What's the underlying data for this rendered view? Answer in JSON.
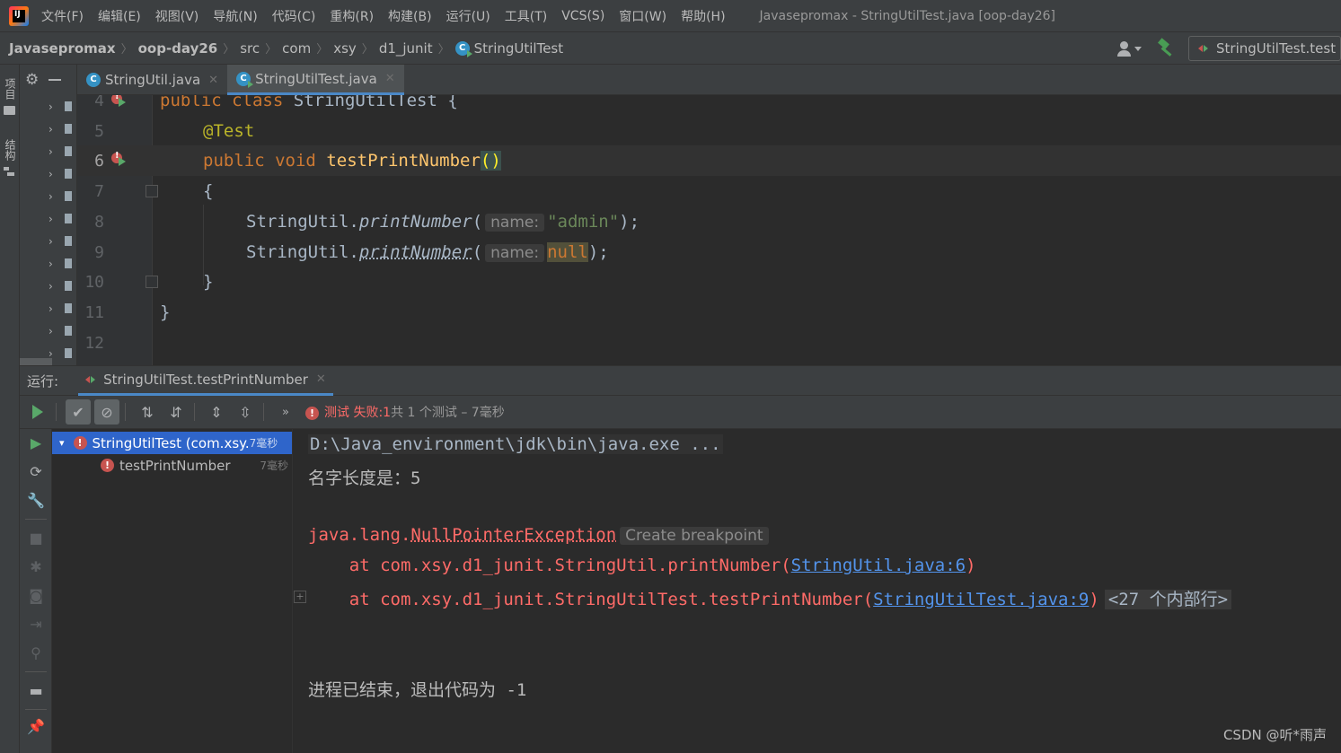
{
  "menubar": {
    "items": [
      "文件(F)",
      "编辑(E)",
      "视图(V)",
      "导航(N)",
      "代码(C)",
      "重构(R)",
      "构建(B)",
      "运行(U)",
      "工具(T)",
      "VCS(S)",
      "窗口(W)",
      "帮助(H)"
    ],
    "window_title": "Javasepromax - StringUtilTest.java [oop-day26]"
  },
  "navbar": {
    "crumbs": [
      "Javasepromax",
      "oop-day26",
      "src",
      "com",
      "xsy",
      "d1_junit",
      "StringUtilTest"
    ],
    "run_config": "StringUtilTest.test"
  },
  "left_strip": {
    "project_tab": "项目",
    "structure_tab": "结构"
  },
  "editor_tabs": [
    {
      "label": "StringUtil.java",
      "active": false
    },
    {
      "label": "StringUtilTest.java",
      "active": true
    }
  ],
  "editor": {
    "line_numbers": [
      "4",
      "5",
      "6",
      "7",
      "8",
      "9",
      "10",
      "11",
      "12"
    ],
    "line4": {
      "kw1": "public",
      "kw2": "class",
      "name": "StringUtilTest",
      "brace": "{"
    },
    "line5": {
      "annotation": "@Test"
    },
    "line6": {
      "kw1": "public",
      "kw2": "void",
      "fn": "testPrintNumber",
      "parens": "()"
    },
    "line7": {
      "brace": "{"
    },
    "line8": {
      "cls": "StringUtil",
      "dot": ".",
      "method": "printNumber",
      "open": "(",
      "hint": "name:",
      "arg": "\"admin\"",
      "close": ");"
    },
    "line9": {
      "cls": "StringUtil",
      "dot": ".",
      "method": "printNumber",
      "open": "(",
      "hint": "name:",
      "arg": "null",
      "close": ");"
    },
    "line10": {
      "brace": "}"
    },
    "line11": {
      "brace": "}"
    }
  },
  "run_panel": {
    "label": "运行:",
    "tab": "StringUtilTest.testPrintNumber",
    "status_failed": "测试 失败:",
    "status_count": "1",
    "status_rest": "共 1 个测试 – 7毫秒",
    "tree": [
      {
        "label": "StringUtilTest (com.xsy.",
        "time": "7毫秒"
      },
      {
        "label": "testPrintNumber",
        "time": "7毫秒"
      }
    ],
    "console": {
      "cmd": "D:\\Java_environment\\jdk\\bin\\java.exe ...",
      "output1": "名字长度是：5",
      "exc_prefix": "java.lang.",
      "exc_name": "NullPointerException",
      "exc_hint": "Create breakpoint",
      "trace1_prefix": "    at com.xsy.d1_junit.StringUtil.printNumber(",
      "trace1_link": "StringUtil.java:6",
      "trace1_suffix": ")",
      "trace2_prefix": "    at com.xsy.d1_junit.StringUtilTest.testPrintNumber(",
      "trace2_link": "StringUtilTest.java:9",
      "trace2_suffix": ")",
      "trace2_fold": "<27 个内部行>",
      "exit": "进程已结束，退出代码为 -1"
    }
  },
  "watermark": "CSDN @听*雨声",
  "colors": {
    "background": "#2b2b2b",
    "keyword": "#cc7832",
    "annotation": "#bbb529",
    "method": "#ffc66d",
    "string": "#6a8759",
    "error": "#ff6b68",
    "link": "#5394ec",
    "selection": "#2f65ca"
  }
}
